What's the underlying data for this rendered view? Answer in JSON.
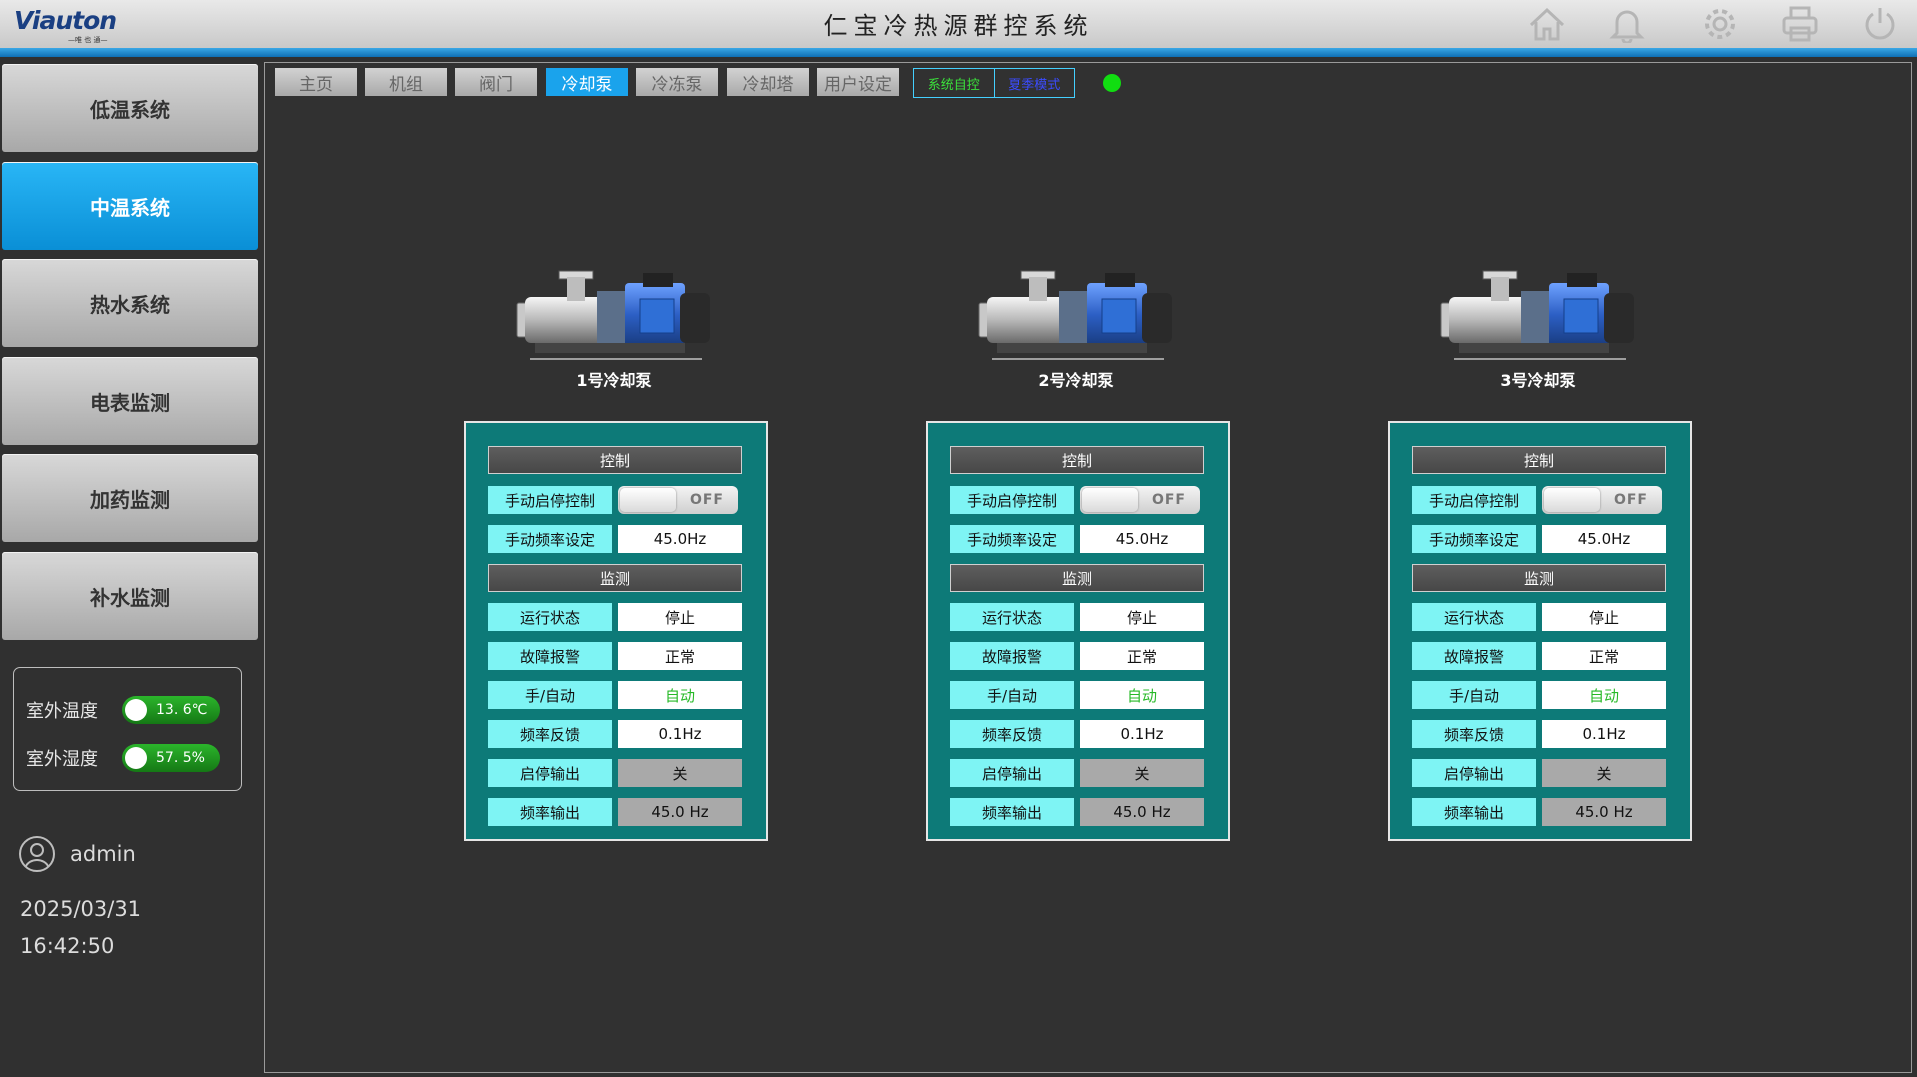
{
  "header": {
    "logo_text": "Viauton",
    "logo_sub": "—唯 也 通—",
    "title": "仁宝冷热源群控系统",
    "icons": [
      "home-icon",
      "bell-icon",
      "gear-icon",
      "printer-icon",
      "power-icon"
    ]
  },
  "sidebar": {
    "items": [
      {
        "label": "低温系统",
        "active": false
      },
      {
        "label": "中温系统",
        "active": true
      },
      {
        "label": "热水系统",
        "active": false
      },
      {
        "label": "电表监测",
        "active": false
      },
      {
        "label": "加药监测",
        "active": false
      },
      {
        "label": "补水监测",
        "active": false
      }
    ],
    "weather": {
      "temp_label": "室外温度",
      "temp_value": "13. 6℃",
      "hum_label": "室外湿度",
      "hum_value": "57. 5%"
    },
    "user": "admin",
    "date": "2025/03/31",
    "time": "16:42:50"
  },
  "nav": {
    "tabs": [
      {
        "label": "主页",
        "active": false
      },
      {
        "label": "机组",
        "active": false
      },
      {
        "label": "阀门",
        "active": false
      },
      {
        "label": "冷却泵",
        "active": true
      },
      {
        "label": "冷冻泵",
        "active": false
      },
      {
        "label": "冷却塔",
        "active": false
      },
      {
        "label": "用户设定",
        "active": false
      }
    ],
    "mode_auto": "系统自控",
    "mode_season": "夏季模式",
    "status_color": "#11dd11"
  },
  "pumps": [
    {
      "name": "1号冷却泵",
      "control_header": "控制",
      "manual_switch_label": "手动启停控制",
      "manual_switch_state": "OFF",
      "manual_freq_label": "手动频率设定",
      "manual_freq_value": "45.0Hz",
      "monitor_header": "监测",
      "run_status_label": "运行状态",
      "run_status_value": "停止",
      "fault_label": "故障报警",
      "fault_value": "正常",
      "mode_label": "手/自动",
      "mode_value": "自动",
      "freq_fb_label": "频率反馈",
      "freq_fb_value": "0.1Hz",
      "start_out_label": "启停输出",
      "start_out_value": "关",
      "freq_out_label": "频率输出",
      "freq_out_value": "45.0 Hz"
    },
    {
      "name": "2号冷却泵",
      "control_header": "控制",
      "manual_switch_label": "手动启停控制",
      "manual_switch_state": "OFF",
      "manual_freq_label": "手动频率设定",
      "manual_freq_value": "45.0Hz",
      "monitor_header": "监测",
      "run_status_label": "运行状态",
      "run_status_value": "停止",
      "fault_label": "故障报警",
      "fault_value": "正常",
      "mode_label": "手/自动",
      "mode_value": "自动",
      "freq_fb_label": "频率反馈",
      "freq_fb_value": "0.1Hz",
      "start_out_label": "启停输出",
      "start_out_value": "关",
      "freq_out_label": "频率输出",
      "freq_out_value": "45.0 Hz"
    },
    {
      "name": "3号冷却泵",
      "control_header": "控制",
      "manual_switch_label": "手动启停控制",
      "manual_switch_state": "OFF",
      "manual_freq_label": "手动频率设定",
      "manual_freq_value": "45.0Hz",
      "monitor_header": "监测",
      "run_status_label": "运行状态",
      "run_status_value": "停止",
      "fault_label": "故障报警",
      "fault_value": "正常",
      "mode_label": "手/自动",
      "mode_value": "自动",
      "freq_fb_label": "频率反馈",
      "freq_fb_value": "0.1Hz",
      "start_out_label": "启停输出",
      "start_out_value": "关",
      "freq_out_label": "频率输出",
      "freq_out_value": "45.0 Hz"
    }
  ]
}
